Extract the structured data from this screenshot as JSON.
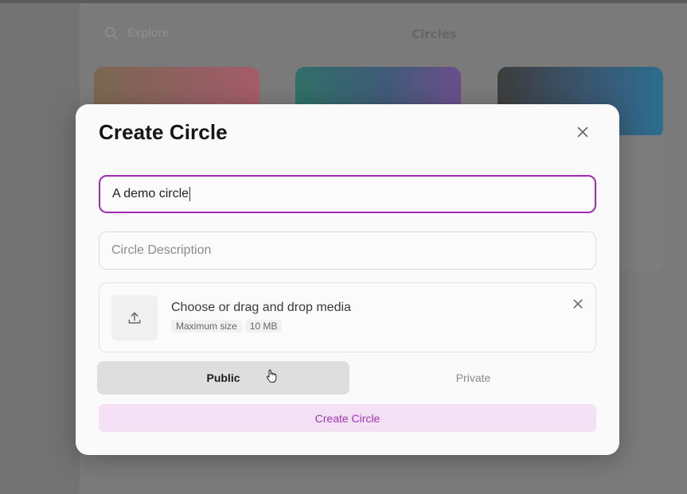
{
  "background": {
    "search_placeholder": "Explore",
    "header_label": "Circles",
    "icons": {
      "search": "search-icon"
    }
  },
  "modal": {
    "title": "Create Circle",
    "close_icon": "close-icon",
    "name_field": {
      "value": "A demo circle",
      "focused": true
    },
    "description_field": {
      "placeholder": "Circle Description",
      "value": ""
    },
    "upload": {
      "title": "Choose or drag and drop media",
      "meta_label": "Maximum size",
      "meta_value": "10 MB",
      "icon": "upload-icon",
      "remove_icon": "close-icon"
    },
    "visibility": {
      "options": [
        "Public",
        "Private"
      ],
      "selected": "Public"
    },
    "submit_label": "Create Circle"
  },
  "colors": {
    "accent": "#a12bb3",
    "submit_bg": "#f5e1f5",
    "submit_text": "#a432b7"
  }
}
